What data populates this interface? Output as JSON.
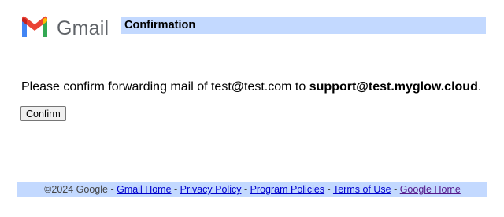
{
  "header": {
    "logo_icon": "gmail-m-logo-icon",
    "logo_text": "Gmail",
    "title": "Confirmation"
  },
  "message": {
    "prefix": "Please confirm forwarding mail of test@test.com to ",
    "target": "support@test.myglow.cloud",
    "suffix": "."
  },
  "confirm_label": "Confirm",
  "footer": {
    "copyright": "©2024 Google",
    "separator": " - ",
    "links": [
      "Gmail Home",
      "Privacy Policy",
      "Program Policies",
      "Terms of Use",
      "Google Home"
    ]
  },
  "colors": {
    "bar": "#c3d9ff",
    "link": "#0000cc",
    "visited_link": "#551a8b"
  }
}
